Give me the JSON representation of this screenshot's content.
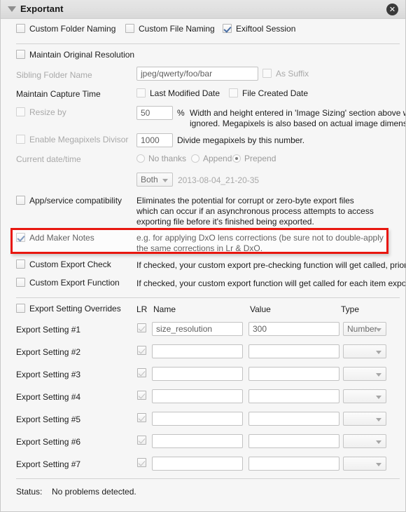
{
  "panel": {
    "title": "Exportant",
    "disclosure_icon": "triangle-down-icon",
    "close_icon": "close-circle-icon",
    "close_glyph": "✕"
  },
  "top_checkboxes": [
    {
      "label": "Custom Folder Naming",
      "checked": false
    },
    {
      "label": "Custom File Naming",
      "checked": false
    },
    {
      "label": "Exiftool Session",
      "checked": true
    }
  ],
  "maintain_resolution": {
    "label": "Maintain Original Resolution",
    "checked": false
  },
  "sibling_folder": {
    "label": "Sibling Folder Name",
    "value": "jpeg/qwerty/foo/bar",
    "as_suffix_label": "As Suffix",
    "as_suffix_checked": false
  },
  "capture_time": {
    "label": "Maintain Capture Time",
    "options": [
      {
        "label": "Last Modified Date",
        "checked": false
      },
      {
        "label": "File Created Date",
        "checked": false
      }
    ]
  },
  "resize": {
    "label": "Resize by",
    "checked": false,
    "value": "50",
    "unit": "%",
    "desc_line1": "Width and height entered in 'Image Sizing' section above will be",
    "desc_line2": "ignored. Megapixels is also based on actual image dimensions…"
  },
  "megapixels": {
    "label": "Enable Megapixels Divisor",
    "checked": false,
    "value": "1000",
    "desc": "Divide megapixels by this number."
  },
  "current_datetime": {
    "label": "Current date/time",
    "radios": [
      {
        "label": "No thanks",
        "selected": false
      },
      {
        "label": "Append",
        "selected": false
      },
      {
        "label": "Prepend",
        "selected": true
      }
    ],
    "mode_select": "Both",
    "preview": "2013-08-04_21-20-35"
  },
  "app_compat": {
    "label": "App/service compatibility",
    "checked": false,
    "desc_line1": "Eliminates the potential for corrupt or zero-byte export files",
    "desc_line2": "which can occur if an asynchronous process attempts to access",
    "desc_line3": "exporting file before it's finished being exported."
  },
  "maker_notes": {
    "label": "Add Maker Notes",
    "checked": true,
    "highlighted": true,
    "highlight_color": "#e8170f",
    "desc_line1": "e.g. for applying DxO lens corrections (be sure not to double-apply",
    "desc_line2": "the same corrections in Lr & DxO."
  },
  "custom_export_check": {
    "label": "Custom Export Check",
    "checked": false,
    "desc": "If checked, your custom export pre-checking function will get called, prior to exp"
  },
  "custom_export_function": {
    "label": "Custom Export Function",
    "checked": false,
    "desc": "If checked, your custom export function will get called for each item exported."
  },
  "overrides": {
    "label": "Export Setting Overrides",
    "checked": false,
    "columns": {
      "lr": "LR",
      "name": "Name",
      "value": "Value",
      "type": "Type"
    },
    "rows": [
      {
        "label": "Export Setting #1",
        "lr_checked": true,
        "name": "size_resolution",
        "value": "300",
        "type": "Number"
      },
      {
        "label": "Export Setting #2",
        "lr_checked": true,
        "name": "",
        "value": "",
        "type": ""
      },
      {
        "label": "Export Setting #3",
        "lr_checked": true,
        "name": "",
        "value": "",
        "type": ""
      },
      {
        "label": "Export Setting #4",
        "lr_checked": true,
        "name": "",
        "value": "",
        "type": ""
      },
      {
        "label": "Export Setting #5",
        "lr_checked": true,
        "name": "",
        "value": "",
        "type": ""
      },
      {
        "label": "Export Setting #6",
        "lr_checked": true,
        "name": "",
        "value": "",
        "type": ""
      },
      {
        "label": "Export Setting #7",
        "lr_checked": true,
        "name": "",
        "value": "",
        "type": ""
      }
    ]
  },
  "status": {
    "label": "Status:",
    "value": "No problems detected."
  }
}
